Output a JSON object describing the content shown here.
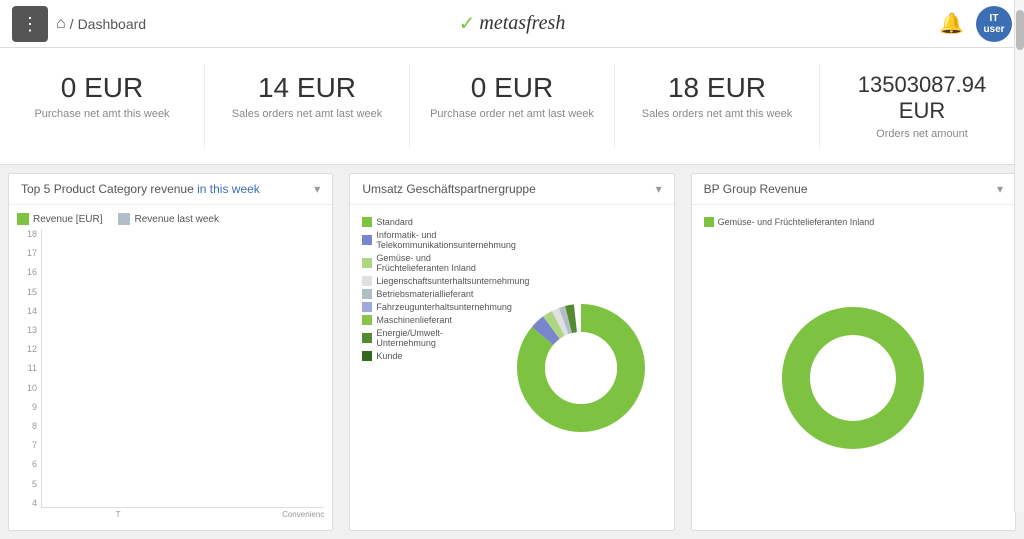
{
  "topbar": {
    "menu_icon": "⋮",
    "home_icon": "⌂",
    "breadcrumb_separator": "/",
    "breadcrumb_page": "Dashboard",
    "logo_text": "metasfresh",
    "logo_check": "✓",
    "bell_icon": "🔔",
    "avatar_text": "IT\nuser"
  },
  "kpis": [
    {
      "value": "0 EUR",
      "label": "Purchase net amt this week"
    },
    {
      "value": "14 EUR",
      "label": "Sales orders net amt last week"
    },
    {
      "value": "0 EUR",
      "label": "Purchase order net amt last week"
    },
    {
      "value": "18 EUR",
      "label": "Sales orders net amt this week"
    },
    {
      "value": "13503087.94 EUR",
      "label": "Orders net amount"
    }
  ],
  "charts": {
    "bar_chart": {
      "title": "Top 5 Product Category revenue ",
      "title_highlight": "in this week",
      "dropdown_icon": "▾",
      "legend": [
        {
          "label": "Revenue [EUR]",
          "color": "#7dc241"
        },
        {
          "label": "Revenue last week",
          "color": "#b0bec5"
        }
      ],
      "y_labels": [
        "18",
        "17",
        "16",
        "15",
        "14",
        "13",
        "12",
        "11",
        "10",
        "9",
        "8",
        "7",
        "6",
        "5",
        "4"
      ],
      "bars": [
        {
          "green_h": 180,
          "gray_h": 10,
          "label": ""
        },
        {
          "green_h": 10,
          "gray_h": 50,
          "label": "T"
        },
        {
          "green_h": 5,
          "gray_h": 60,
          "label": ""
        },
        {
          "green_h": 3,
          "gray_h": 5,
          "label": "Convenienc"
        }
      ]
    },
    "donut_chart1": {
      "title": "Umsatz Geschäftspartnergruppe",
      "dropdown_icon": "▾",
      "legend": [
        {
          "label": "Standard",
          "color": "#7dc241"
        },
        {
          "label": "Informatik- und Telekommunikationsunternehmung",
          "color": "#7986cb"
        },
        {
          "label": "Gemüse- und Früchtelieferanten Inland",
          "color": "#aed581"
        },
        {
          "label": "Liegenschaftsunterhaltsunternehmung",
          "color": "#e0e0e0"
        },
        {
          "label": "Betriebsmateriallieferant",
          "color": "#b0bec5"
        },
        {
          "label": "Fahrzeugunterhaltsunternehmung",
          "color": "#9fa8da"
        },
        {
          "label": "Maschinenlieferant",
          "color": "#8bc34a"
        },
        {
          "label": "Energie/Umwelt-Unternehmung",
          "color": "#558b2f"
        },
        {
          "label": "Kunde",
          "color": "#33691e"
        }
      ]
    },
    "donut_chart2": {
      "title": "BP Group Revenue",
      "dropdown_icon": "▾",
      "legend": [
        {
          "label": "Gemüse- und Früchtelieferanten Inland",
          "color": "#7dc241"
        }
      ]
    }
  }
}
